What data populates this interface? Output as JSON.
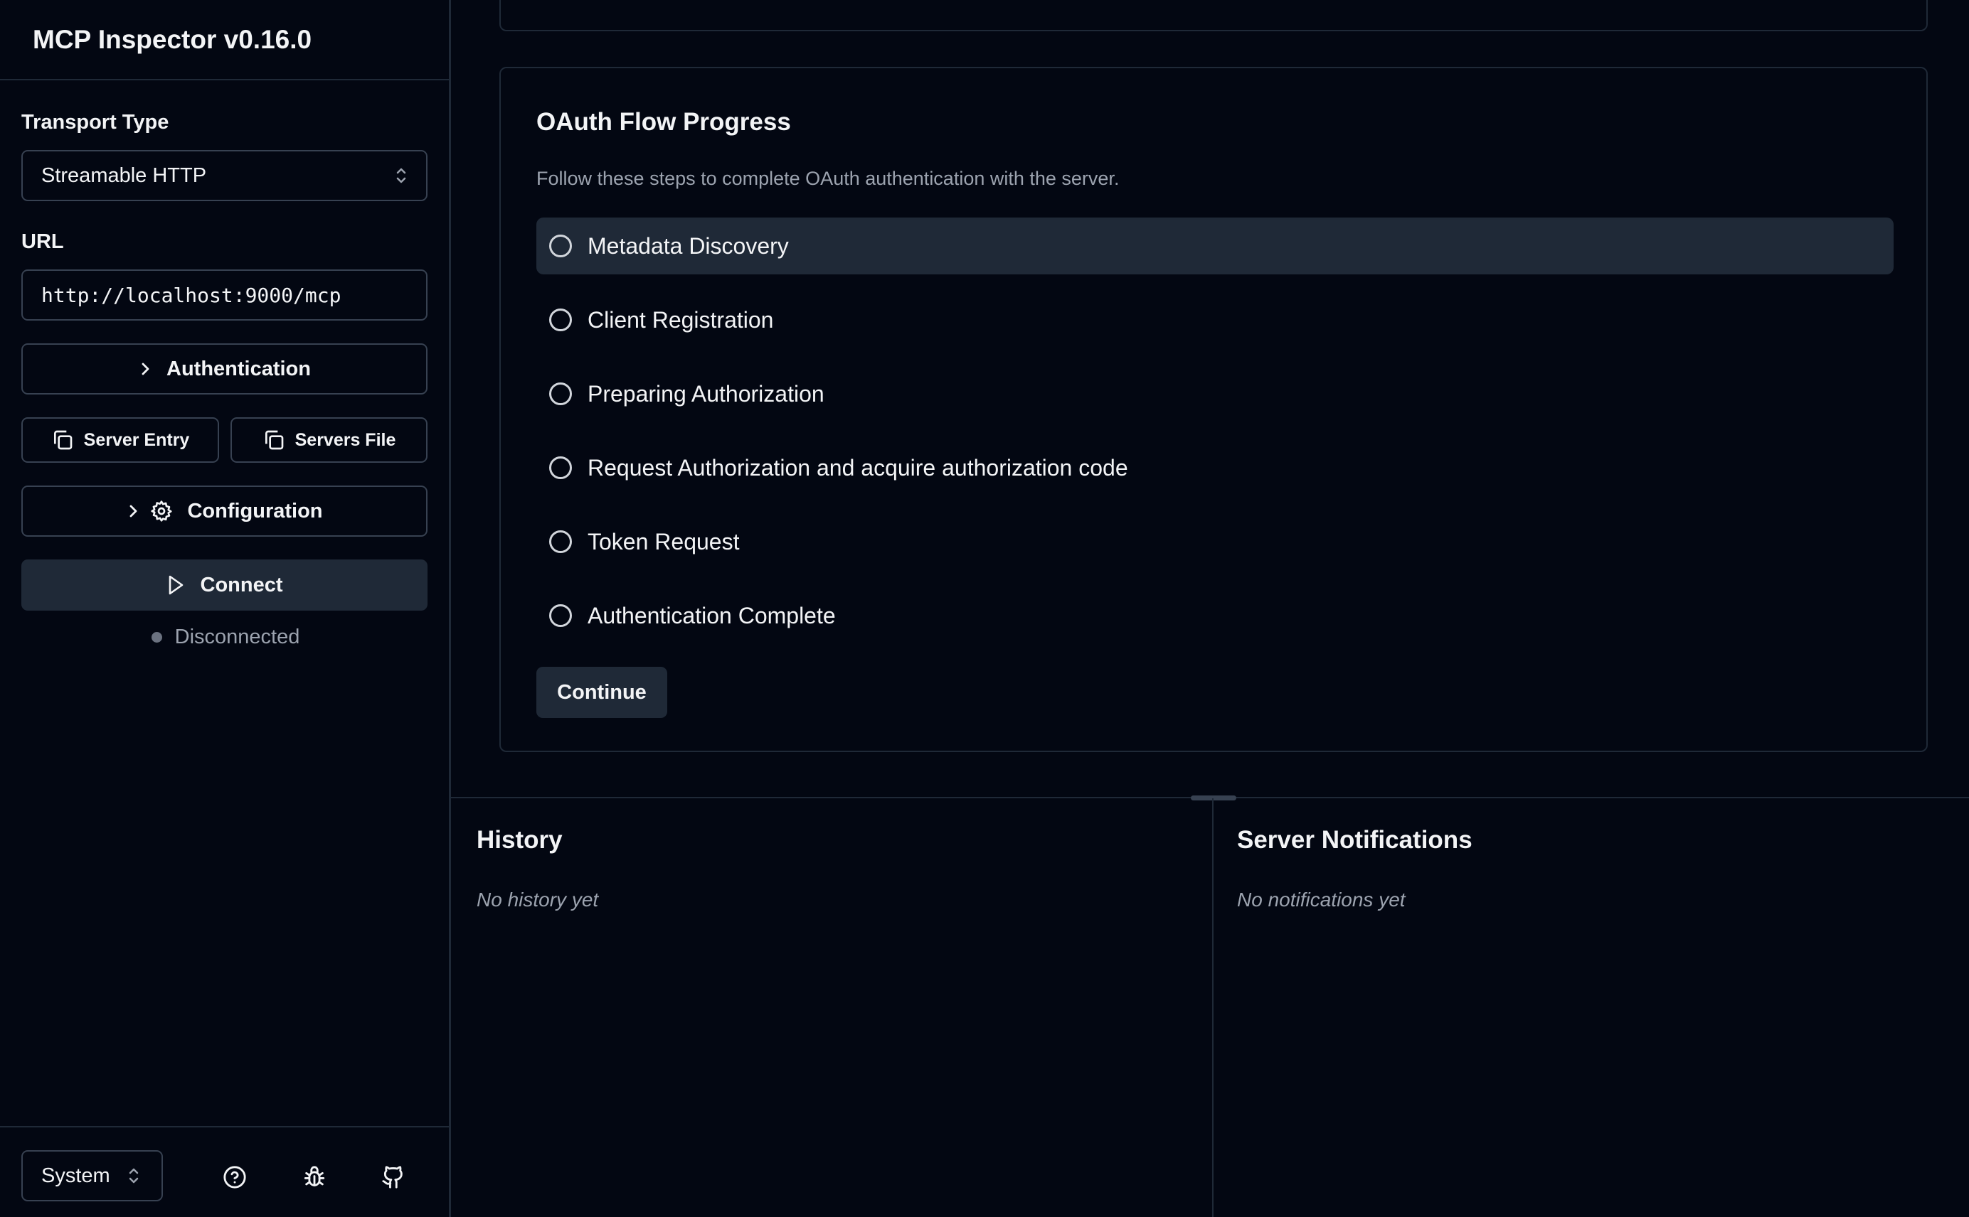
{
  "app": {
    "title": "MCP Inspector v0.16.0"
  },
  "sidebar": {
    "transport_label": "Transport Type",
    "transport_value": "Streamable HTTP",
    "url_label": "URL",
    "url_value": "http://localhost:9000/mcp",
    "authentication_label": "Authentication",
    "server_entry_label": "Server Entry",
    "servers_file_label": "Servers File",
    "configuration_label": "Configuration",
    "connect_label": "Connect",
    "status_text": "Disconnected",
    "theme_value": "System",
    "footer_icons": [
      "help-circle-icon",
      "bug-icon",
      "github-icon"
    ]
  },
  "oauth": {
    "title": "OAuth Flow Progress",
    "description": "Follow these steps to complete OAuth authentication with the server.",
    "steps": [
      {
        "label": "Metadata Discovery",
        "active": true
      },
      {
        "label": "Client Registration",
        "active": false
      },
      {
        "label": "Preparing Authorization",
        "active": false
      },
      {
        "label": "Request Authorization and acquire authorization code",
        "active": false
      },
      {
        "label": "Token Request",
        "active": false
      },
      {
        "label": "Authentication Complete",
        "active": false
      }
    ],
    "continue_label": "Continue"
  },
  "history": {
    "title": "History",
    "empty_text": "No history yet"
  },
  "notifications": {
    "title": "Server Notifications",
    "empty_text": "No notifications yet"
  },
  "colors": {
    "background": "#030712",
    "border": "#1f2937",
    "muted_text": "#9ca3af",
    "active_bg": "#1f2937"
  }
}
